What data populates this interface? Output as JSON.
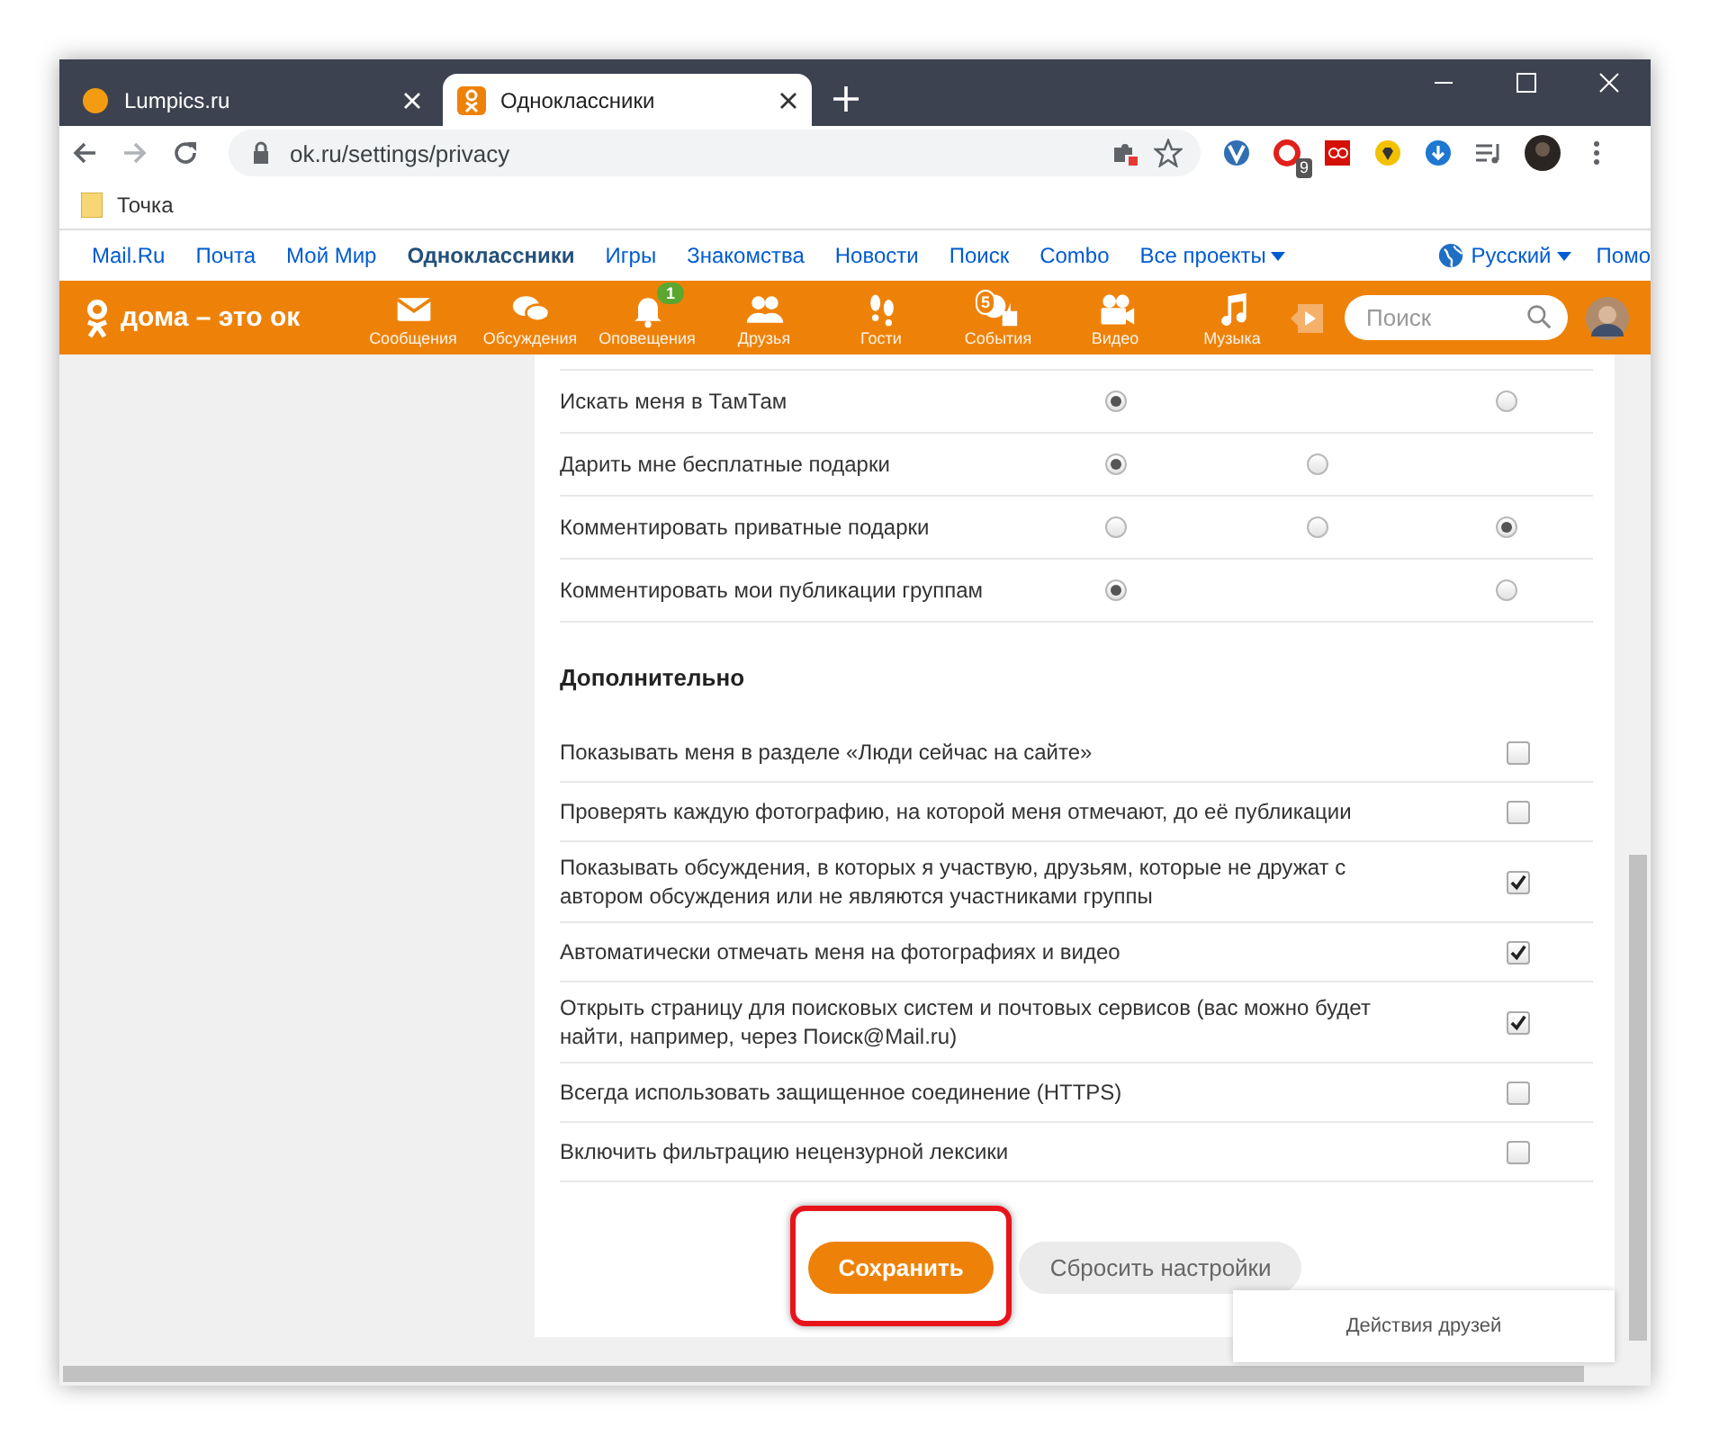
{
  "browser": {
    "tabs": [
      {
        "title": "Lumpics.ru",
        "selected": false
      },
      {
        "title": "Одноклассники",
        "selected": true
      }
    ],
    "nav_buttons": [
      {
        "kind": "back",
        "disabled": false
      },
      {
        "kind": "forward",
        "disabled": true
      },
      {
        "kind": "reload",
        "disabled": false
      }
    ],
    "address": "ok.ru/settings/privacy",
    "extension_badge": "9",
    "bookmarks": [
      {
        "title": "Точка"
      }
    ]
  },
  "portal_bar": {
    "links": [
      {
        "label": "Mail.Ru",
        "selected": false,
        "dropdown": false
      },
      {
        "label": "Почта",
        "selected": false,
        "dropdown": false
      },
      {
        "label": "Мой Мир",
        "selected": false,
        "dropdown": false
      },
      {
        "label": "Одноклассники",
        "selected": true,
        "dropdown": false
      },
      {
        "label": "Игры",
        "selected": false,
        "dropdown": false
      },
      {
        "label": "Знакомства",
        "selected": false,
        "dropdown": false
      },
      {
        "label": "Новости",
        "selected": false,
        "dropdown": false
      },
      {
        "label": "Поиск",
        "selected": false,
        "dropdown": false
      },
      {
        "label": "Combo",
        "selected": false,
        "dropdown": false
      },
      {
        "label": "Все проекты",
        "selected": false,
        "dropdown": true
      }
    ],
    "language": "Русский",
    "help": "Помо"
  },
  "site_header": {
    "logo_text": "дома – это ок",
    "nav": [
      {
        "label": "Сообщения",
        "kind": "envelope"
      },
      {
        "label": "Обсуждения",
        "kind": "chat"
      },
      {
        "label": "Оповещения",
        "kind": "bell",
        "badge": "1"
      },
      {
        "label": "Друзья",
        "kind": "friends"
      },
      {
        "label": "Гости",
        "kind": "footprints"
      },
      {
        "label": "События",
        "kind": "events",
        "badge": "5"
      },
      {
        "label": "Видео",
        "kind": "camera"
      },
      {
        "label": "Музыка",
        "kind": "note"
      }
    ],
    "search": {
      "placeholder": "Поиск"
    }
  },
  "privacy_rows": [
    {
      "label": "Искать меня в ТамТам",
      "options": [
        {
          "kind": "radio",
          "selected": true
        },
        {
          "kind": "none"
        },
        {
          "kind": "radio",
          "selected": false
        }
      ]
    },
    {
      "label": "Дарить мне бесплатные подарки",
      "options": [
        {
          "kind": "radio",
          "selected": true
        },
        {
          "kind": "radio",
          "selected": false
        },
        {
          "kind": "none"
        }
      ]
    },
    {
      "label": "Комментировать приватные подарки",
      "options": [
        {
          "kind": "radio",
          "selected": false
        },
        {
          "kind": "radio",
          "selected": false
        },
        {
          "kind": "radio",
          "selected": true
        }
      ]
    },
    {
      "label": "Комментировать мои публикации группам",
      "options": [
        {
          "kind": "radio",
          "selected": true
        },
        {
          "kind": "none"
        },
        {
          "kind": "radio",
          "selected": false
        }
      ]
    }
  ],
  "additional": {
    "title": "Дополнительно",
    "options": [
      {
        "label": "Показывать меня в разделе «Люди сейчас на сайте»",
        "checked": false
      },
      {
        "label": "Проверять каждую фотографию, на которой меня отмечают, до её публикации",
        "checked": false
      },
      {
        "label": "Показывать обсуждения, в которых я участвую, друзьям, которые не дружат с автором обсуждения или не являются участниками группы",
        "checked": true
      },
      {
        "label": "Автоматически отмечать меня на фотографиях и видео",
        "checked": true
      },
      {
        "label": "Открыть страницу для поисковых систем и почтовых сервисов (вас можно будет найти, например, через Поиск@Mail.ru)",
        "checked": true
      },
      {
        "label": "Всегда использовать защищенное соединение (HTTPS)",
        "checked": false
      },
      {
        "label": "Включить фильтрацию нецензурной лексики",
        "checked": false
      }
    ]
  },
  "buttons": [
    {
      "label": "Сохранить",
      "kind": "primary",
      "highlighted": true
    },
    {
      "label": "Сбросить настройки",
      "kind": "secondary",
      "highlighted": false
    }
  ],
  "popup": {
    "title": "Действия друзей"
  }
}
